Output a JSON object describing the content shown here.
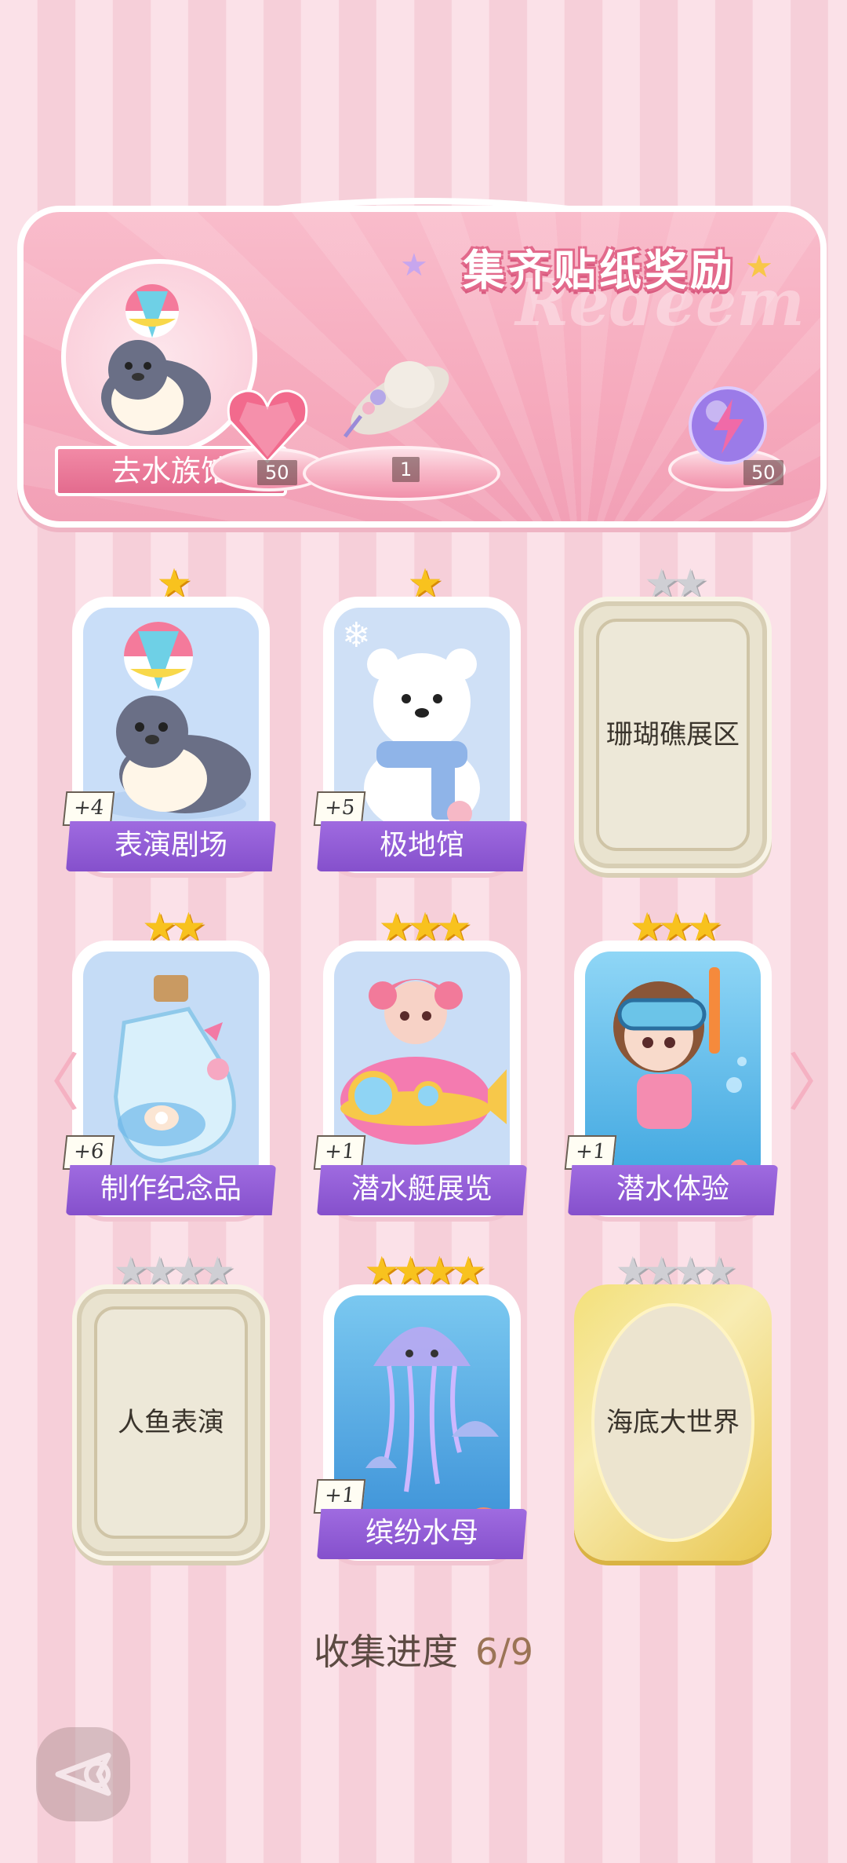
{
  "banner": {
    "title": "集齐贴纸奖励",
    "watermark": "Redeem",
    "goto_button": "去水族馆",
    "rewards": [
      {
        "icon": "pink-heart-gem-icon",
        "count": "50"
      },
      {
        "icon": "flower-hat-icon",
        "count": "1"
      },
      {
        "icon": "lightning-orb-icon",
        "count": "50"
      }
    ]
  },
  "cards": [
    {
      "label": "表演剧场",
      "bonus": "+4",
      "stars": 1,
      "max_stars": 1,
      "unlocked": true,
      "art": "seal-with-ball"
    },
    {
      "label": "极地馆",
      "bonus": "+5",
      "stars": 1,
      "max_stars": 1,
      "unlocked": true,
      "art": "polar-bear"
    },
    {
      "label": "珊瑚礁展区",
      "stars": 0,
      "max_stars": 2,
      "unlocked": false
    },
    {
      "label": "制作纪念品",
      "bonus": "+6",
      "stars": 2,
      "max_stars": 2,
      "unlocked": true,
      "art": "bottle"
    },
    {
      "label": "潜水艇展览",
      "bonus": "+1",
      "stars": 3,
      "max_stars": 3,
      "unlocked": true,
      "art": "submarine"
    },
    {
      "label": "潜水体验",
      "bonus": "+1",
      "stars": 3,
      "max_stars": 3,
      "unlocked": true,
      "art": "diver"
    },
    {
      "label": "人鱼表演",
      "stars": 0,
      "max_stars": 4,
      "unlocked": false
    },
    {
      "label": "缤纷水母",
      "bonus": "+1",
      "stars": 4,
      "max_stars": 4,
      "unlocked": true,
      "art": "jellyfish"
    },
    {
      "label": "海底大世界",
      "stars": 0,
      "max_stars": 4,
      "unlocked": false,
      "gold": true
    }
  ],
  "progress": {
    "label": "收集进度",
    "value": "6/9"
  },
  "colors": {
    "ribbon": "#8550cc",
    "star_gold": "#f8c21e",
    "star_grey": "#cfcfd4",
    "banner": "#f6aabd"
  }
}
